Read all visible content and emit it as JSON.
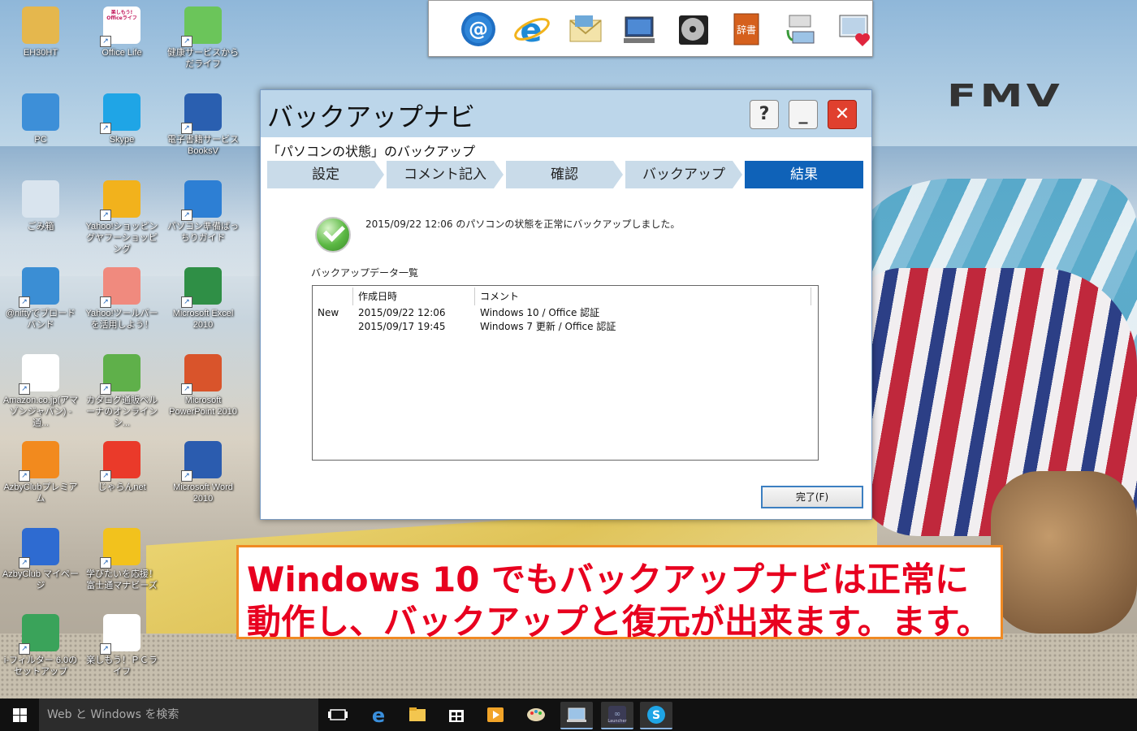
{
  "desktop": {
    "icons": [
      {
        "label": "EH30HT",
        "icon": "user-folder-icon"
      },
      {
        "label": "Office Life",
        "icon": "office-life-icon",
        "tile_text": "楽しもう! Officeライフ"
      },
      {
        "label": "健康サービスからだライフ",
        "icon": "health-service-icon"
      },
      {
        "label": "PC",
        "icon": "pc-icon"
      },
      {
        "label": "Skype",
        "icon": "skype-icon"
      },
      {
        "label": "電子書籍サービスBooksV",
        "icon": "ebook-service-icon"
      },
      {
        "label": "ごみ箱",
        "icon": "recycle-bin-icon"
      },
      {
        "label": "Yahoo!ショッピングヤフーショッピング",
        "icon": "yahoo-shopping-icon"
      },
      {
        "label": "パソコン準備ばっちりガイド",
        "icon": "pc-setup-guide-icon"
      },
      {
        "label": "@niftyでブロードバンド",
        "icon": "nifty-icon"
      },
      {
        "label": "Yahoo!ツールバーを活用しよう！",
        "icon": "yahoo-toolbar-icon"
      },
      {
        "label": "Microsoft Excel 2010",
        "icon": "excel-icon"
      },
      {
        "label": "Amazon.co.jp(アマゾンジャパン) - 通...",
        "icon": "amazon-icon"
      },
      {
        "label": "カタログ通販ベルーナのオンラインシ...",
        "icon": "belluna-icon"
      },
      {
        "label": "Microsoft PowerPoint 2010",
        "icon": "powerpoint-icon"
      },
      {
        "label": "AzbyClubプレミアム",
        "icon": "azbyclub-premium-icon"
      },
      {
        "label": "じゃらんnet",
        "icon": "jalan-icon"
      },
      {
        "label": "Microsoft Word 2010",
        "icon": "word-icon"
      },
      {
        "label": "AzbyClub マイページ",
        "icon": "azbyclub-mypage-icon"
      },
      {
        "label": "学びたいを応援！富士通マナビーズ",
        "icon": "manabees-icon"
      },
      {
        "label": "i-フィルター 6.0のセットアップ",
        "icon": "i-filter-icon"
      },
      {
        "label": "楽しもう！ＰＣライフ",
        "icon": "wdlc-icon"
      }
    ],
    "brand_logo": "FMV"
  },
  "toolbar": {
    "items": [
      "email-icon",
      "internet-explorer-icon",
      "mail-envelope-icon",
      "computer-settings-icon",
      "media-disc-icon",
      "dictionary-icon",
      "printer-network-icon",
      "favorite-pc-icon"
    ],
    "dictionary_text": "辞書"
  },
  "dialog": {
    "title": "バックアップナビ",
    "help_label": "?",
    "min_label": "_",
    "close_label": "✕",
    "subtitle": "「パソコンの状態」のバックアップ",
    "steps": [
      {
        "label": "設定",
        "active": false
      },
      {
        "label": "コメント記入",
        "active": false
      },
      {
        "label": "確認",
        "active": false
      },
      {
        "label": "バックアップ",
        "active": false
      },
      {
        "label": "結果",
        "active": true
      }
    ],
    "message": "2015/09/22 12:06 のパソコンの状態を正常にバックアップしました。",
    "list_label": "バックアップデータ一覧",
    "list_columns": [
      "",
      "作成日時",
      "コメント"
    ],
    "list_rows": [
      {
        "flag": "New",
        "date": "2015/09/22 12:06",
        "comment": "Windows 10 / Office 認証"
      },
      {
        "flag": "",
        "date": "2015/09/17 19:45",
        "comment": "Windows 7 更新 / Office 認証"
      }
    ],
    "done_label": "完了(F)",
    "accent_color": "#0f62b8",
    "titlebar_color": "#bcd6ea"
  },
  "annotation": {
    "line1": "Windows 10 でもバックアップナビは正常に",
    "line2": "動作し、バックアップと復元が出来ます。ます。",
    "text_color": "#e8001f",
    "border_color": "#f08a24"
  },
  "taskbar": {
    "search_placeholder": "Web と Windows を検索",
    "items": [
      "task-view-icon",
      "edge-icon",
      "file-explorer-icon",
      "store-icon",
      "media-player-icon",
      "paint-icon",
      "backup-navi-icon",
      "launcher-icon",
      "skype-icon"
    ],
    "launcher_text": "Launcher"
  }
}
